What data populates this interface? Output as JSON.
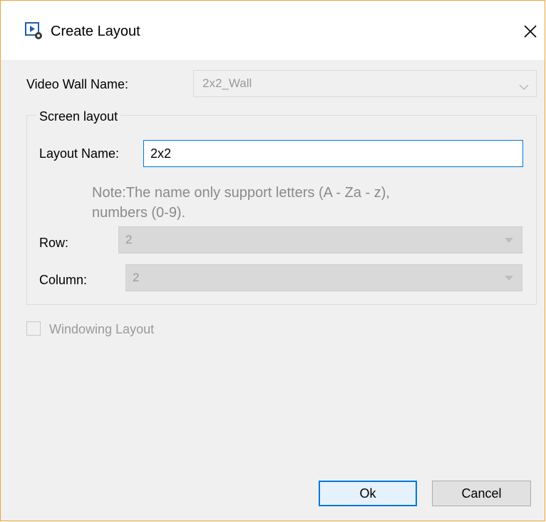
{
  "window": {
    "title": "Create Layout"
  },
  "video_wall": {
    "label": "Video Wall Name:",
    "value": "2x2_Wall"
  },
  "screen_layout": {
    "group_title": "Screen layout",
    "layout_name_label": "Layout Name:",
    "layout_name_value": "2x2",
    "note_line1": "Note:The name only support letters (A - Za - z),",
    "note_line2": "numbers (0-9).",
    "row_label": "Row:",
    "row_value": "2",
    "column_label": "Column:",
    "column_value": "2"
  },
  "windowing": {
    "label": "Windowing Layout",
    "checked": false
  },
  "buttons": {
    "ok": "Ok",
    "cancel": "Cancel"
  },
  "colors": {
    "accent": "#0078d7",
    "window_border": "#e8a33c"
  }
}
